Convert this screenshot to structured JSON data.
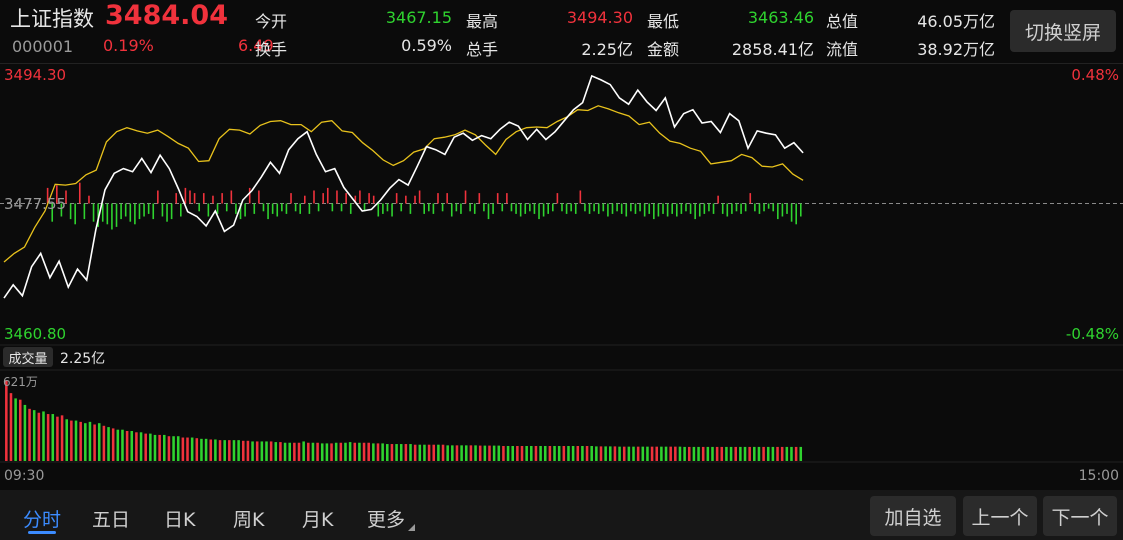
{
  "header": {
    "index_name": "上证指数",
    "last_price": "3484.04",
    "code": "000001",
    "change_pct": "0.19%",
    "change_abs": "6.49",
    "stats": [
      {
        "label": "今开",
        "value": "3467.15",
        "color": "green"
      },
      {
        "label": "最高",
        "value": "3494.30",
        "color": "red"
      },
      {
        "label": "最低",
        "value": "3463.46",
        "color": "green"
      },
      {
        "label": "总值",
        "value": "46.05万亿",
        "color": "white"
      },
      {
        "label": "换手",
        "value": "0.59%",
        "color": "white"
      },
      {
        "label": "总手",
        "value": "2.25亿",
        "color": "white"
      },
      {
        "label": "金额",
        "value": "2858.41亿",
        "color": "white"
      },
      {
        "label": "流值",
        "value": "38.92万亿",
        "color": "white"
      }
    ],
    "switch_label": "切换竖屏"
  },
  "price_axis": {
    "top": "3494.30",
    "mid": "3477.55",
    "bottom": "3460.80",
    "top_pct": "0.48%",
    "bottom_pct": "-0.48%"
  },
  "volume_panel": {
    "badge": "成交量",
    "total": "2.25亿",
    "max_label": "621万"
  },
  "time_axis": {
    "start": "09:30",
    "end": "15:00"
  },
  "tabs": [
    "分时",
    "五日",
    "日K",
    "周K",
    "月K",
    "更多"
  ],
  "active_tab": "分时",
  "buttons": {
    "add_watch": "加自选",
    "prev": "上一个",
    "next": "下一个"
  },
  "colors": {
    "up": "#f0323c",
    "down": "#2fd32f",
    "price_line": "#ffffff",
    "avg_line": "#e8c21c",
    "background": "#0b0b0b"
  },
  "chart_data": {
    "type": "line",
    "ylim": [
      3460.8,
      3494.3
    ],
    "y_mid": 3477.55,
    "x_range": [
      "09:30",
      "15:00"
    ],
    "price": [
      3465.5,
      3467.2,
      3465.8,
      3469.5,
      3471.2,
      3468.1,
      3470.2,
      3466.9,
      3469.2,
      3467.8,
      3474.2,
      3479.3,
      3481.4,
      3482.0,
      3481.6,
      3483.3,
      3481.5,
      3483.7,
      3482.0,
      3479.4,
      3476.5,
      3475.9,
      3474.7,
      3476.6,
      3474.0,
      3474.8,
      3478.0,
      3479.2,
      3480.9,
      3482.8,
      3481.4,
      3484.4,
      3485.8,
      3486.7,
      3483.8,
      3481.6,
      3482.0,
      3479.6,
      3478.1,
      3476.6,
      3476.8,
      3478.0,
      3479.5,
      3480.6,
      3479.9,
      3482.3,
      3484.8,
      3484.4,
      3483.8,
      3486.0,
      3486.5,
      3485.6,
      3486.2,
      3485.8,
      3487.0,
      3487.9,
      3487.4,
      3485.7,
      3487.0,
      3485.7,
      3486.7,
      3488.1,
      3489.5,
      3490.4,
      3493.8,
      3493.3,
      3492.7,
      3491.0,
      3490.2,
      3492.0,
      3490.5,
      3489.4,
      3491.0,
      3487.3,
      3489.0,
      3489.5,
      3487.8,
      3488.0,
      3486.6,
      3489.0,
      3488.1,
      3484.6,
      3486.8,
      3486.5,
      3486.3,
      3484.6,
      3485.3,
      3484.0
    ],
    "average": [
      3470.1,
      3471.2,
      3472.0,
      3474.5,
      3476.6,
      3480.0,
      3479.9,
      3480.1,
      3481.2,
      3481.8,
      3485.4,
      3486.7,
      3487.2,
      3486.8,
      3486.5,
      3486.9,
      3486.1,
      3485.2,
      3484.6,
      3482.9,
      3483.0,
      3485.8,
      3487.0,
      3486.9,
      3486.4,
      3487.5,
      3488.0,
      3488.1,
      3487.6,
      3487.6,
      3486.7,
      3487.9,
      3488.1,
      3486.8,
      3486.6,
      3485.3,
      3484.3,
      3483.1,
      3482.4,
      3483.0,
      3484.1,
      3484.5,
      3485.8,
      3486.0,
      3486.3,
      3486.9,
      3486.3,
      3485.0,
      3483.8,
      3485.7,
      3486.7,
      3487.2,
      3487.3,
      3487.2,
      3488.0,
      3488.6,
      3489.5,
      3489.4,
      3490.0,
      3489.6,
      3489.1,
      3488.7,
      3487.6,
      3487.9,
      3486.5,
      3485.5,
      3485.2,
      3484.6,
      3484.2,
      3482.6,
      3482.8,
      3483.0,
      3483.8,
      3483.4,
      3482.3,
      3482.2,
      3482.6,
      3481.3,
      3480.5
    ],
    "volume_max": 621,
    "volume_unit": "万",
    "volumes": [
      620,
      520,
      480,
      470,
      430,
      400,
      390,
      370,
      380,
      360,
      360,
      340,
      350,
      320,
      310,
      310,
      300,
      290,
      300,
      280,
      290,
      270,
      260,
      250,
      240,
      240,
      230,
      230,
      220,
      220,
      210,
      210,
      200,
      200,
      200,
      190,
      190,
      190,
      180,
      180,
      180,
      175,
      170,
      170,
      165,
      165,
      160,
      160,
      160,
      160,
      160,
      155,
      155,
      150,
      150,
      150,
      150,
      150,
      145,
      145,
      140,
      140,
      140,
      140,
      150,
      140,
      140,
      140,
      135,
      135,
      135,
      140,
      140,
      140,
      145,
      140,
      140,
      140,
      140,
      135,
      135,
      135,
      130,
      130,
      130,
      130,
      130,
      130,
      125,
      125,
      125,
      125,
      125,
      125,
      125,
      120,
      120,
      120,
      120,
      120,
      120,
      120,
      118,
      118,
      118,
      118,
      118,
      115,
      115,
      115,
      115,
      115,
      115,
      115,
      115,
      115,
      115,
      115,
      115,
      115,
      115,
      115,
      115,
      115,
      115,
      115,
      115,
      112,
      112,
      112,
      112,
      112,
      110,
      110,
      110,
      110,
      110,
      110,
      110,
      110,
      110,
      110,
      110,
      110,
      110,
      110,
      108,
      108,
      108,
      108,
      108,
      108,
      108,
      108,
      108,
      108,
      108,
      108,
      108,
      108,
      108,
      108,
      108,
      108,
      108,
      108,
      108,
      108,
      108,
      108,
      108,
      108,
      108,
      108,
      108,
      108,
      108,
      108,
      108,
      108,
      108,
      108,
      108,
      108,
      108,
      108,
      108,
      108,
      108,
      108,
      108,
      108,
      108,
      108,
      108,
      108,
      108,
      108,
      108,
      108,
      108,
      108,
      108,
      108,
      108,
      108,
      108,
      108,
      108,
      108,
      108,
      108,
      108,
      108,
      108,
      108,
      108,
      108,
      108,
      108,
      108,
      108,
      108,
      108,
      108,
      108,
      108,
      108,
      108,
      108,
      108,
      108,
      108,
      108,
      108,
      108,
      108,
      108,
      108,
      108,
      108,
      108,
      108,
      108,
      108,
      108,
      108,
      108
    ],
    "volume_up": [
      1,
      1,
      0,
      1,
      0,
      1,
      0,
      1,
      0,
      1,
      0,
      1,
      1,
      0,
      1,
      0,
      1,
      0,
      0,
      1,
      0,
      1,
      0,
      1,
      0,
      0,
      1,
      0,
      1,
      0,
      1,
      0,
      0,
      1,
      0,
      1,
      0,
      0,
      1,
      1,
      0,
      1,
      0,
      0,
      1,
      0,
      1,
      0,
      1,
      0,
      0,
      1,
      1,
      0,
      1,
      0,
      0,
      1,
      0,
      1,
      0,
      0,
      1,
      1,
      0,
      1,
      0,
      1,
      0,
      0,
      1,
      0,
      1,
      0,
      0,
      1,
      0,
      1,
      1,
      0,
      1,
      0,
      0,
      1,
      0,
      0,
      1,
      0,
      1,
      0,
      0,
      1,
      1,
      0,
      1,
      0,
      0,
      1,
      0,
      0,
      1,
      0,
      1,
      0,
      1,
      0,
      0,
      1,
      0,
      0,
      1,
      1,
      0,
      0,
      1,
      0,
      0,
      1,
      0,
      0,
      1,
      0,
      0,
      1,
      0,
      1,
      0,
      0,
      1,
      0,
      0,
      1,
      0,
      1,
      0,
      0,
      1,
      0,
      0,
      1,
      1,
      0,
      0,
      1,
      1,
      0,
      0,
      1,
      0,
      0,
      1,
      0,
      0,
      1,
      1,
      0,
      0,
      1,
      0,
      0,
      1,
      0,
      0,
      1,
      0,
      0,
      1,
      1,
      0,
      0,
      1,
      0,
      0,
      1,
      0,
      0,
      1,
      0,
      0,
      1,
      1,
      0,
      0,
      1,
      0,
      0,
      1,
      0,
      0,
      1,
      0,
      0,
      1,
      1,
      0,
      0,
      1,
      0,
      0,
      1,
      0,
      0,
      1,
      0,
      0,
      1,
      1,
      0,
      0,
      1,
      0,
      0,
      1,
      0,
      0,
      1,
      0,
      0,
      1,
      1,
      0,
      0,
      1,
      0,
      0,
      1,
      0,
      0,
      1,
      0,
      0,
      1,
      1,
      0,
      0,
      1,
      0,
      0,
      1,
      0,
      0,
      1,
      0,
      0,
      1,
      1,
      0,
      0
    ],
    "volume_slots": 240,
    "filled_slots": 172,
    "net_flow": [
      0,
      0,
      0,
      0,
      0,
      0,
      0,
      0,
      0,
      6,
      -7,
      7,
      -5,
      5,
      -6,
      -8,
      8,
      -6,
      3,
      -7,
      -9,
      -7,
      -8,
      -10,
      -9,
      -6,
      -5,
      -7,
      -8,
      -6,
      -5,
      -4,
      -6,
      5,
      -5,
      -7,
      -6,
      4,
      -5,
      6,
      5,
      4,
      -3,
      4,
      -5,
      3,
      -4,
      4,
      -3,
      5,
      -4,
      -6,
      -5,
      6,
      -4,
      5,
      -3,
      -6,
      -4,
      -5,
      -3,
      -4,
      4,
      -3,
      -4,
      3,
      -4,
      5,
      -3,
      4,
      6,
      -3,
      5,
      -3,
      4,
      -4,
      3,
      5,
      -3,
      4,
      3,
      -5,
      -4,
      -3,
      -5,
      4,
      -3,
      3,
      -4,
      3,
      5,
      -4,
      -3,
      -4,
      4,
      -3,
      4,
      -5,
      -3,
      -4,
      5,
      -3,
      -4,
      4,
      -3,
      -6,
      -4,
      4,
      -3,
      4,
      -3,
      -4,
      -5,
      -4,
      -3,
      -4,
      -6,
      -5,
      -4,
      -3,
      4,
      -3,
      -4,
      -3,
      -4,
      5,
      -3,
      -4,
      -3,
      -4,
      -3,
      -5,
      -4,
      -3,
      -4,
      -5,
      -3,
      -4,
      -3,
      -5,
      -4,
      -6,
      -5,
      -4,
      -5,
      -4,
      -5,
      -4,
      -3,
      -4,
      -6,
      -5,
      -4,
      -3,
      -4,
      3,
      -4,
      -5,
      -4,
      -3,
      -4,
      -3,
      4,
      -3,
      -4,
      -3,
      -2,
      -3,
      -6,
      -5,
      -4,
      -7,
      -8,
      -5
    ]
  }
}
